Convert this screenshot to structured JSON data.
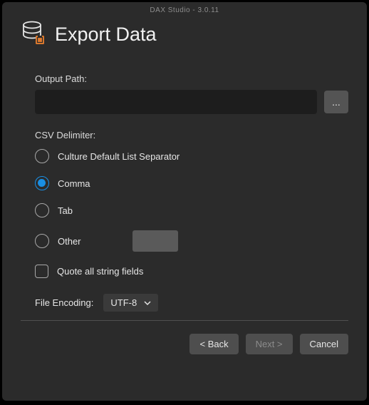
{
  "app_title": "DAX Studio - 3.0.11",
  "header": {
    "title": "Export Data"
  },
  "output": {
    "label": "Output Path:",
    "value": "",
    "browse_label": "..."
  },
  "delimiter": {
    "label": "CSV Delimiter:",
    "options": [
      {
        "label": "Culture Default List Separator",
        "checked": false
      },
      {
        "label": "Comma",
        "checked": true
      },
      {
        "label": "Tab",
        "checked": false
      },
      {
        "label": "Other",
        "checked": false
      }
    ],
    "other_value": "",
    "quote_label": "Quote all string fields",
    "quote_checked": false
  },
  "encoding": {
    "label": "File Encoding:",
    "value": "UTF-8"
  },
  "buttons": {
    "back": "< Back",
    "next": "Next >",
    "cancel": "Cancel"
  }
}
